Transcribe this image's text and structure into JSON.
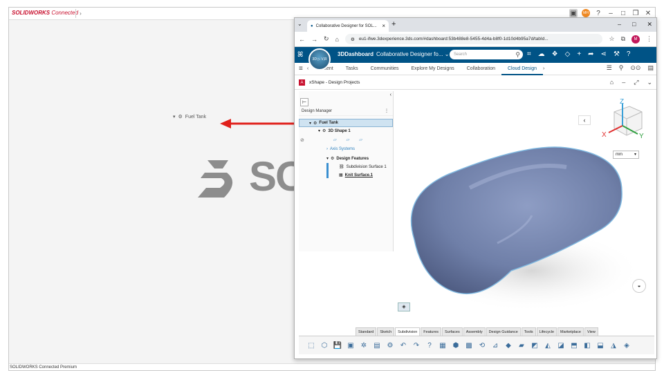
{
  "solidworks": {
    "logo_brand": "SOLIDWORKS",
    "logo_suffix": " Connected",
    "tab_arrow": "›",
    "status": "SOLIDWORKS Connected Premium",
    "tree_item": "Fuel Tank",
    "big_logo_text": "SO"
  },
  "browser": {
    "tab_title": "Collaborative Designer for SOL...",
    "url": "eu1-ifwe.3dexperience.3ds.com/#dashboard:53b488e8-5455-4d4a-b8f0-1d10d4b95a7d/tabId...",
    "avatar_letter": "M"
  },
  "dashboard": {
    "brand": "3DDashboard",
    "subtitle": "Collaborative Designer fo...",
    "search_placeholder": "Search",
    "compass_label": "3D  ▷  V,R",
    "tabs": [
      "Content",
      "Tasks",
      "Communities",
      "Explore My Designs",
      "Collaboration",
      "Cloud Design"
    ],
    "active_tab": "Cloud Design"
  },
  "app": {
    "title": "xShape - Design Projects",
    "units": "mm"
  },
  "design_manager": {
    "header": "Design Manager",
    "root": "Fuel Tank",
    "shape": "3D Shape 1",
    "axis": "Axis Systems",
    "features": "Design Features",
    "subdivision": "Subdivision Surface 1",
    "knit": "Knit Surface.1"
  },
  "axis_labels": {
    "x": "X",
    "y": "Y",
    "z": "Z"
  },
  "action_tabs": [
    "Standard",
    "Sketch",
    "Subdivision",
    "Features",
    "Surfaces",
    "Assembly",
    "Design Guidance",
    "Tools",
    "Lifecycle",
    "Marketplace",
    "View"
  ],
  "active_action_tab": "Subdivision",
  "colors": {
    "dash_blue": "#005386",
    "shape_fill": "#6f7fa8",
    "red_arrow": "#e0201b"
  }
}
